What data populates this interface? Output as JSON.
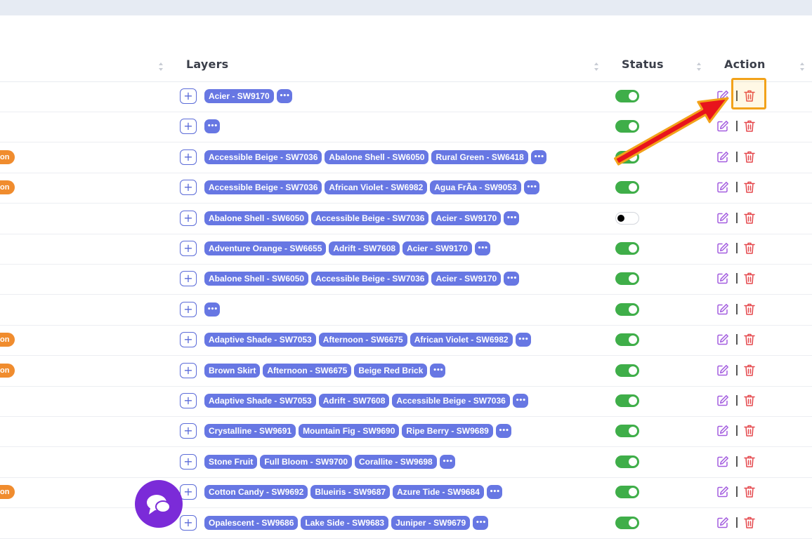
{
  "table": {
    "headers": {
      "layers": "Layers",
      "status": "Status",
      "action": "Action"
    },
    "add_symbol": "+",
    "more_symbol": "•••",
    "rows": [
      {
        "badge": "",
        "layers": [
          "Acier - SW9170"
        ],
        "status": "on"
      },
      {
        "badge": "",
        "layers": [],
        "status": "on"
      },
      {
        "badge": "on",
        "layers": [
          "Accessible Beige - SW7036",
          "Abalone Shell - SW6050",
          "Rural Green - SW6418"
        ],
        "status": "on"
      },
      {
        "badge": "on",
        "layers": [
          "Accessible Beige - SW7036",
          "African Violet - SW6982",
          "Agua FrÃ­a - SW9053"
        ],
        "status": "on"
      },
      {
        "badge": "",
        "layers": [
          "Abalone Shell - SW6050",
          "Accessible Beige - SW7036",
          "Acier - SW9170"
        ],
        "status": "off"
      },
      {
        "badge": "",
        "layers": [
          "Adventure Orange - SW6655",
          "Adrift - SW7608",
          "Acier - SW9170"
        ],
        "status": "on"
      },
      {
        "badge": "",
        "layers": [
          "Abalone Shell - SW6050",
          "Accessible Beige - SW7036",
          "Acier - SW9170"
        ],
        "status": "on"
      },
      {
        "badge": "",
        "layers": [],
        "status": "on"
      },
      {
        "badge": "on",
        "layers": [
          "Adaptive Shade - SW7053",
          "Afternoon - SW6675",
          "African Violet - SW6982"
        ],
        "status": "on"
      },
      {
        "badge": "on",
        "layers": [
          "Brown Skirt",
          "Afternoon - SW6675",
          "Beige Red Brick"
        ],
        "status": "on"
      },
      {
        "badge": "",
        "layers": [
          "Adaptive Shade - SW7053",
          "Adrift - SW7608",
          "Accessible Beige - SW7036"
        ],
        "status": "on"
      },
      {
        "badge": "",
        "layers": [
          "Crystalline - SW9691",
          "Mountain Fig - SW9690",
          "Ripe Berry - SW9689"
        ],
        "status": "on"
      },
      {
        "badge": "",
        "layers": [
          "Stone Fruit",
          "Full Bloom - SW9700",
          "Corallite - SW9698"
        ],
        "status": "on"
      },
      {
        "badge": "on",
        "layers": [
          "Cotton Candy - SW9692",
          "Blueiris - SW9687",
          "Azure Tide - SW9684"
        ],
        "status": "on"
      },
      {
        "badge": "",
        "layers": [
          "Opalescent - SW9686",
          "Lake Side - SW9683",
          "Juniper - SW9679"
        ],
        "status": "on"
      }
    ]
  },
  "colors": {
    "chip": "#6777e3",
    "toggle_on": "#3fae49",
    "edit": "#a35ddf",
    "delete": "#e5484d",
    "badge": "#f08c2e",
    "chat": "#7b2bd8"
  },
  "icons": {
    "edit": "edit-icon",
    "delete": "trash-icon",
    "chat": "chat-icon",
    "annotation": "arrow-icon"
  }
}
